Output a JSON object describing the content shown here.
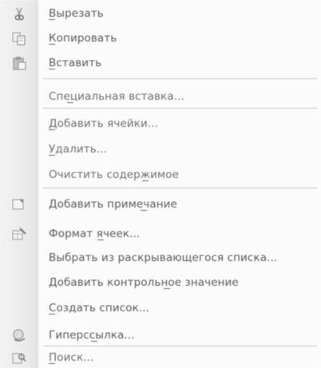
{
  "menu": {
    "items": [
      {
        "label": "Вырезать",
        "icon": "scissors-icon"
      },
      {
        "label": "Копировать",
        "icon": "copy-icon"
      },
      {
        "label": "Вставить",
        "icon": "paste-icon"
      },
      {
        "label": "Специальная вставка..."
      },
      {
        "label": "Добавить ячейки..."
      },
      {
        "label": "Удалить..."
      },
      {
        "label": "Очистить содержимое"
      },
      {
        "label": "Добавить примечание",
        "icon": "comment-icon"
      },
      {
        "label": "Формат ячеек...",
        "icon": "format-cells-icon"
      },
      {
        "label": "Выбрать из раскрывающегося списка..."
      },
      {
        "label": "Добавить контрольное значение"
      },
      {
        "label": "Создать список..."
      },
      {
        "label": "Гиперссылка...",
        "icon": "hyperlink-icon"
      },
      {
        "label": "Поиск...",
        "icon": "research-icon"
      }
    ]
  }
}
